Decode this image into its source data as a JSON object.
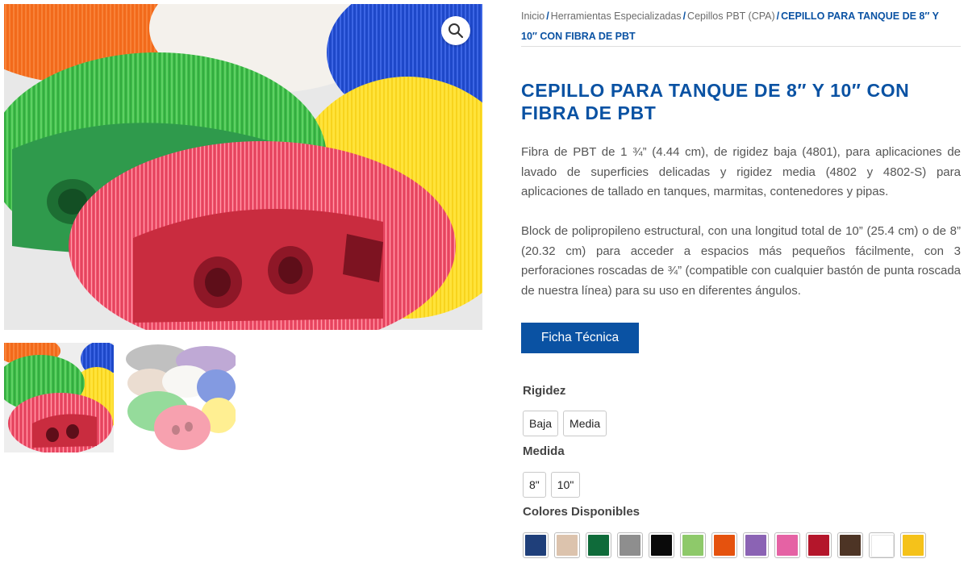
{
  "gallery": {
    "zoom_icon": "magnifier-icon",
    "thumbnails": [
      "thumb-tank-brush",
      "thumb-brush-collection"
    ]
  },
  "breadcrumb": {
    "items": [
      "Inicio",
      "Herramientas Especializadas",
      "Cepillos PBT (CPA)"
    ],
    "separator": "/",
    "current": "CEPILLO PARA TANQUE DE 8″ Y 10″ CON FIBRA DE PBT"
  },
  "product": {
    "title": "CEPILLO PARA TANQUE DE 8″ Y 10″ CON FIBRA DE PBT",
    "description_1": "Fibra de PBT de 1 ¾” (4.44 cm), de rigidez baja (4801), para aplicaciones de lavado de superficies delicadas y rigidez media (4802 y 4802-S) para aplicaciones de tallado en tanques, marmitas, contenedores y pipas.",
    "description_2": "Block de polipropileno estructural, con una longitud total de 10” (25.4 cm) o de 8” (20.32 cm) para acceder a espacios más pequeños fácilmente, con 3 perforaciones roscadas de ¾” (compatible con cualquier bastón de punta roscada de nuestra línea) para su uso en diferentes ángulos.",
    "ficha_button": "Ficha Técnica"
  },
  "options": {
    "rigidez": {
      "label": "Rigidez",
      "values": [
        "Baja",
        "Media"
      ]
    },
    "medida": {
      "label": "Medida",
      "values": [
        "8\"",
        "10\""
      ]
    },
    "colores": {
      "label": "Colores Disponibles",
      "swatches": [
        "#1f3f7a",
        "#dcc3ad",
        "#0f6b3a",
        "#8e8e8e",
        "#0a0a0a",
        "#8ec96a",
        "#e5520e",
        "#8b63b4",
        "#e562a4",
        "#b4162b",
        "#4d3425",
        "#ffffff",
        "#f5c21a"
      ]
    }
  },
  "colors": {
    "accent": "#0a52a3"
  }
}
